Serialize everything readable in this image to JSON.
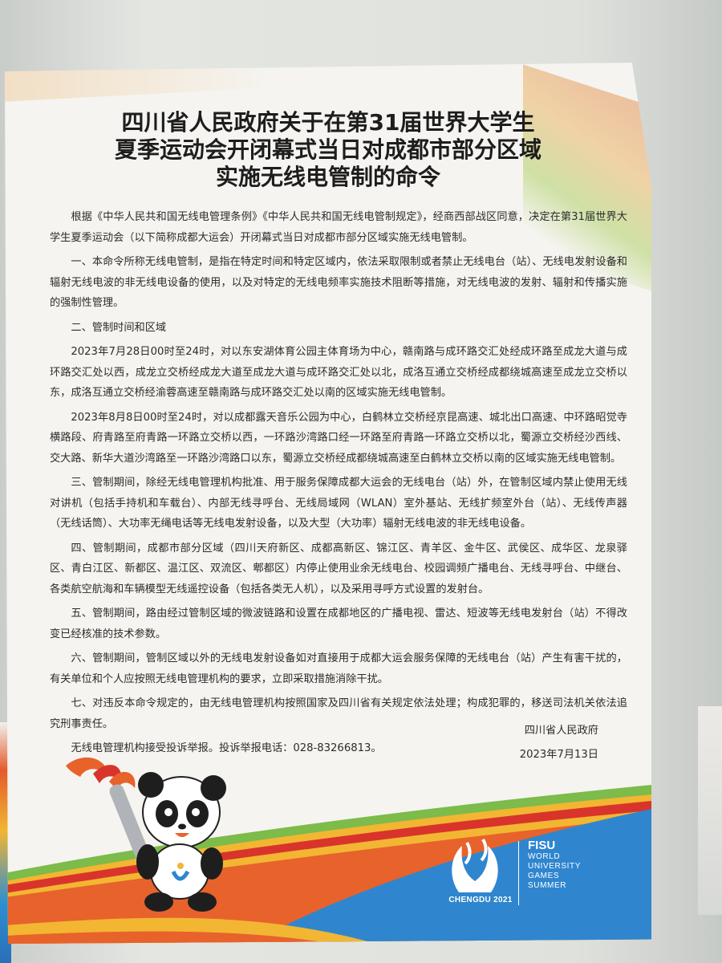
{
  "title": {
    "line1": "四川省人民政府关于在第31届世界大学生",
    "line2": "夏季运动会开闭幕式当日对成都市部分区域",
    "line3": "实施无线电管制的命令"
  },
  "paragraphs": [
    "根据《中华人民共和国无线电管理条例》《中华人民共和国无线电管制规定》，经商西部战区同意，决定在第31届世界大学生夏季运动会（以下简称成都大运会）开闭幕式当日对成都市部分区域实施无线电管制。",
    "一、本命令所称无线电管制，是指在特定时间和特定区域内，依法采取限制或者禁止无线电台（站）、无线电发射设备和辐射无线电波的非无线电设备的使用，以及对特定的无线电频率实施技术阻断等措施，对无线电波的发射、辐射和传播实施的强制性管理。",
    "二、管制时间和区域",
    "2023年7月28日00时至24时，对以东安湖体育公园主体育场为中心，赣南路与成环路交汇处经成环路至成龙大道与成环路交汇处以西，成龙立交桥经成龙大道至成龙大道与成环路交汇处以北，成洛互通立交桥经成都绕城高速至成龙立交桥以东，成洛互通立交桥经渝蓉高速至赣南路与成环路交汇处以南的区域实施无线电管制。",
    "2023年8月8日00时至24时，对以成都露天音乐公园为中心，白鹤林立交桥经京昆高速、城北出口高速、中环路昭觉寺横路段、府青路至府青路一环路立交桥以西，一环路沙湾路口经一环路至府青路一环路立交桥以北，蜀源立交桥经沙西线、交大路、新华大道沙湾路至一环路沙湾路口以东，蜀源立交桥经成都绕城高速至白鹤林立交桥以南的区域实施无线电管制。",
    "三、管制期间，除经无线电管理机构批准、用于服务保障成都大运会的无线电台（站）外，在管制区域内禁止使用无线对讲机（包括手持机和车载台）、内部无线寻呼台、无线局域网（WLAN）室外基站、无线扩频室外台（站）、无线传声器（无线话筒）、大功率无绳电话等无线电发射设备，以及大型（大功率）辐射无线电波的非无线电设备。",
    "四、管制期间，成都市部分区域（四川天府新区、成都高新区、锦江区、青羊区、金牛区、武侯区、成华区、龙泉驿区、青白江区、新都区、温江区、双流区、郫都区）内停止使用业余无线电台、校园调频广播电台、无线寻呼台、中继台、各类航空航海和车辆模型无线遥控设备（包括各类无人机），以及采用寻呼方式设置的发射台。",
    "五、管制期间，路由经过管制区域的微波链路和设置在成都地区的广播电视、雷达、短波等无线电发射台（站）不得改变已经核准的技术参数。",
    "六、管制期间，管制区域以外的无线电发射设备如对直接用于成都大运会服务保障的无线电台（站）产生有害干扰的，有关单位和个人应按照无线电管理机构的要求，立即采取措施消除干扰。",
    "七、对违反本命令规定的，由无线电管理机构按照国家及四川省有关规定依法处理；构成犯罪的，移送司法机关依法追究刑事责任。",
    "无线电管理机构接受投诉举报。投诉举报电话：028-83266813。"
  ],
  "signature": {
    "issuer": "四川省人民政府",
    "date": "2023年7月13日"
  },
  "logos": {
    "chengdu_caption": "CHENGDU 2021",
    "fisu_name": "FISU",
    "fisu_lines": [
      "WORLD",
      "UNIVERSITY",
      "GAMES",
      "SUMMER"
    ]
  },
  "colors": {
    "band_orange": "#e8622c",
    "band_red": "#d9342b",
    "band_yellow": "#f2b632",
    "band_blue": "#2f86cf",
    "band_green": "#7dbb4a"
  },
  "icons": {
    "mascot": "panda-torch-mascot",
    "games_logo": "chengdu-2021-logo"
  }
}
